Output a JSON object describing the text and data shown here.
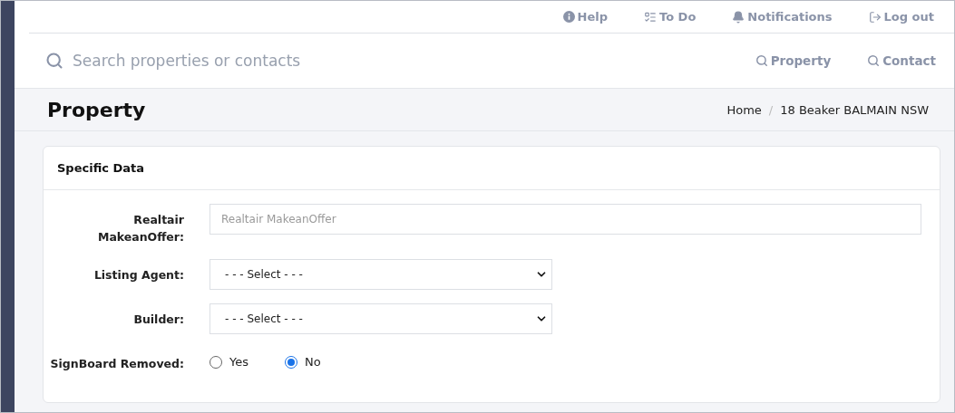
{
  "top_nav": [
    {
      "kind": "help",
      "label": "Help"
    },
    {
      "kind": "todo",
      "label": "To Do"
    },
    {
      "kind": "bell",
      "label": "Notifications"
    },
    {
      "kind": "logout",
      "label": "Log out"
    }
  ],
  "search": {
    "placeholder": "Search properties or contacts",
    "scopes": [
      "Property",
      "Contact"
    ]
  },
  "page": {
    "title": "Property",
    "breadcrumb": [
      "Home",
      "18 Beaker BALMAIN NSW"
    ],
    "breadcrumb_separator": "/"
  },
  "card": {
    "title": "Specific Data",
    "fields": [
      {
        "kind": "text",
        "label": "Realtair MakeanOffer:",
        "placeholder": "Realtair MakeanOffer"
      },
      {
        "kind": "select",
        "label": "Listing Agent:",
        "value": "- - - Select - - -"
      },
      {
        "kind": "select",
        "label": "Builder:",
        "value": "- - - Select - - -"
      },
      {
        "kind": "radio",
        "label": "SignBoard Removed:",
        "options": [
          {
            "label": "Yes",
            "selected": false
          },
          {
            "label": "No",
            "selected": true
          }
        ]
      }
    ]
  }
}
